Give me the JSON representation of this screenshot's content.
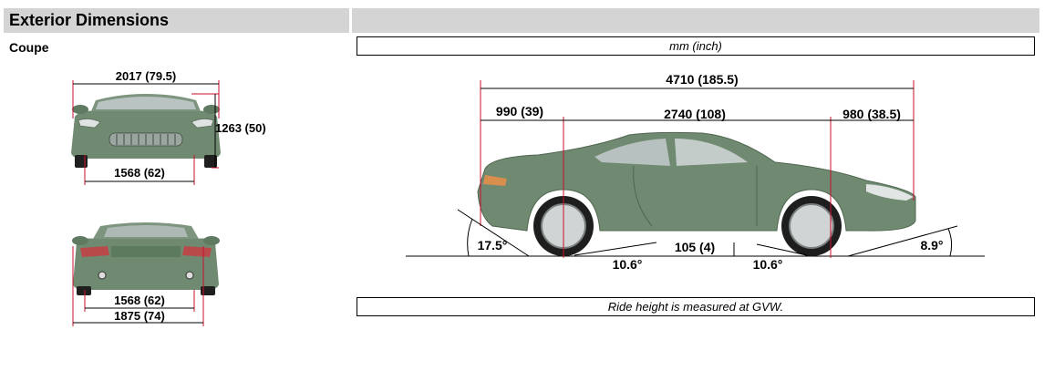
{
  "header": {
    "title": "Exterior Dimensions"
  },
  "variant_label": "Coupe",
  "units_note": "mm (inch)",
  "footnote": "Ride height is measured at GVW.",
  "front_view": {
    "overall_width": "2017 (79.5)",
    "height": "1263 (50)",
    "front_track": "1568 (62)"
  },
  "rear_view": {
    "rear_track": "1568 (62)",
    "body_width": "1875 (74)"
  },
  "side_view": {
    "overall_length": "4710 (185.5)",
    "front_overhang": "990 (39)",
    "wheelbase": "2740 (108)",
    "rear_overhang": "980 (38.5)",
    "approach_angle": "17.5°",
    "ramp_angle_front": "10.6°",
    "ground_clearance": "105 (4)",
    "ramp_angle_rear": "10.6°",
    "departure_angle": "8.9°"
  },
  "colors": {
    "body": "#6f8a70",
    "dimension_line": "#c8102e",
    "header_bg": "#d4d4d4"
  }
}
